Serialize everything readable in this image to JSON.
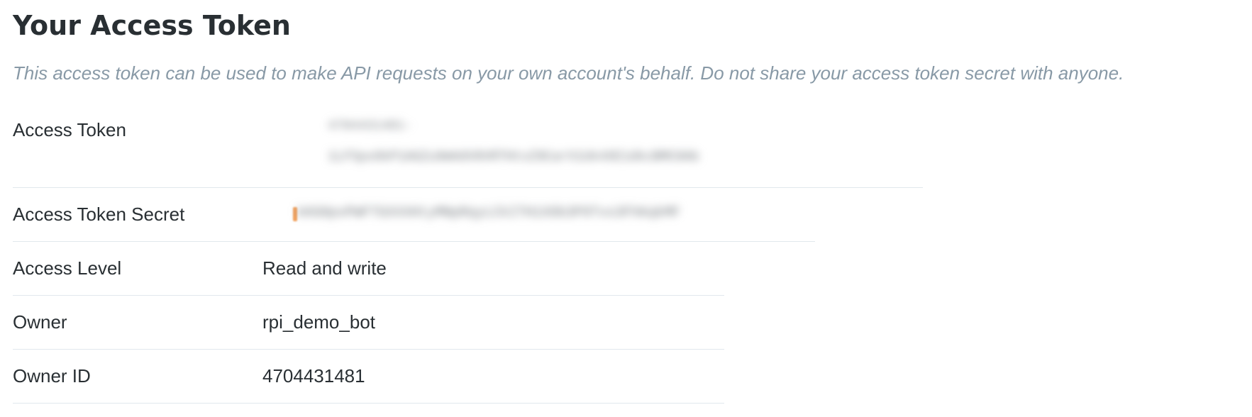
{
  "page": {
    "title": "Your Access Token",
    "description": "This access token can be used to make API requests on your own account's behalf. Do not share your access token secret with anyone."
  },
  "rows": {
    "access_token": {
      "label": "Access Token",
      "value_line1": "4704431481-",
      "value_line2": "1LF5px8kP1AGZu9mHdV0VRTHtvZ9CarX1Uk4XE1dkcBMC0Ab"
    },
    "access_token_secret": {
      "label": "Access Token Secret",
      "value": "kKG0pvPWFTGXXXHtyMNpRqyLCkITH1XOb3P9Tvs3FhKqkMF"
    },
    "access_level": {
      "label": "Access Level",
      "value": "Read and write"
    },
    "owner": {
      "label": "Owner",
      "value": "rpi_demo_bot"
    },
    "owner_id": {
      "label": "Owner ID",
      "value": "4704431481"
    }
  },
  "colors": {
    "text": "#292f33",
    "muted": "#8899a6",
    "divider": "#e1e8ed"
  }
}
